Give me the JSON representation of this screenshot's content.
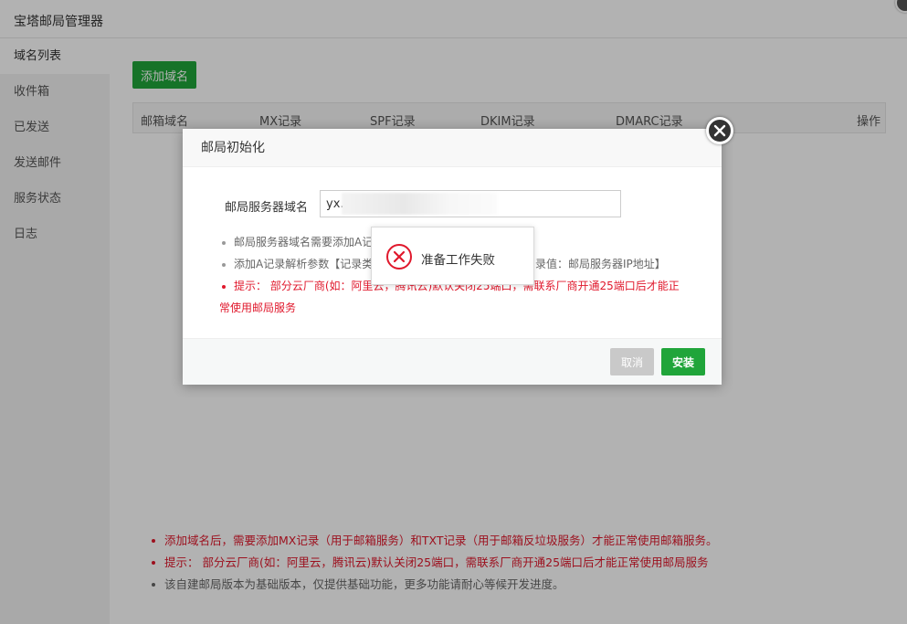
{
  "window": {
    "title": "宝塔邮局管理器"
  },
  "sidebar": {
    "items": [
      {
        "label": "域名列表",
        "active": true
      },
      {
        "label": "收件箱"
      },
      {
        "label": "已发送"
      },
      {
        "label": "发送邮件"
      },
      {
        "label": "服务状态"
      },
      {
        "label": "日志"
      }
    ]
  },
  "main": {
    "add_domain_label": "添加域名",
    "table_headers": [
      "邮箱域名",
      "MX记录",
      "SPF记录",
      "DKIM记录",
      "DMARC记录",
      "操作"
    ],
    "notes": [
      "添加域名后，需要添加MX记录（用于邮箱服务）和TXT记录（用于邮箱反垃圾服务）才能正常使用邮箱服务。",
      "提示： 部分云厂商(如：阿里云，腾讯云)默认关闭25端口，需联系厂商开通25端口后才能正常使用邮局服务",
      "该自建邮局版本为基础版本，仅提供基础功能，更多功能请耐心等候开发进度。"
    ]
  },
  "dialog": {
    "title": "邮局初始化",
    "field_label": "邮局服务器域名",
    "field_value": "yx.",
    "notes": [
      "邮局服务器域名需要添加A记",
      "添加A记录解析参数【记录类",
      "录值：邮局服务器IP地址】",
      "提示： 部分云厂商(如：阿里云，腾讯云)默认关闭25端口，需联系厂商开通25端口后才能正",
      "常使用邮局服务"
    ],
    "cancel_label": "取消",
    "install_label": "安装"
  },
  "toast": {
    "message": "准备工作失败",
    "icon": "error-circle-icon"
  },
  "colors": {
    "accent": "#20a53a",
    "danger": "#e0182c"
  }
}
